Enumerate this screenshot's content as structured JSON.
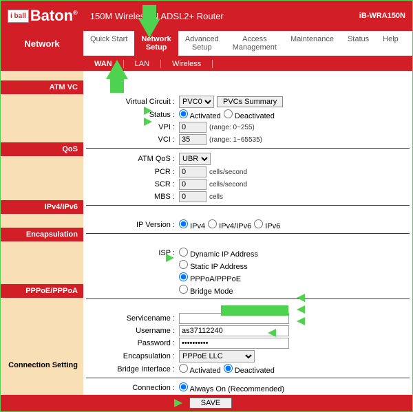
{
  "header": {
    "logo_small": "i ball",
    "logo_main": "Baton",
    "product": "150M Wireless-N ADSL2+ Router",
    "model": "iB-WRA150N"
  },
  "nav": {
    "network": "Network",
    "tabs": [
      "Quick Start",
      "Network Setup",
      "Advanced Setup",
      "Access Management",
      "Maintenance",
      "Status",
      "Help"
    ],
    "active_tab": 1,
    "subtabs": [
      "WAN",
      "LAN",
      "Wireless"
    ],
    "active_subtab": 0
  },
  "sections": {
    "atmvc": "ATM VC",
    "qos": "QoS",
    "ipv": "IPv4/IPv6",
    "encap": "Encapsulation",
    "pppoe": "PPPoE/PPPoA",
    "conn": "Connection Setting"
  },
  "fields": {
    "virtual_circuit_label": "Virtual Circuit :",
    "virtual_circuit_value": "PVC0",
    "pvcs_summary_btn": "PVCs Summary",
    "status_label": "Status :",
    "activated": "Activated",
    "deactivated": "Deactivated",
    "vpi_label": "VPI :",
    "vpi_value": "0",
    "vpi_hint": "(range: 0~255)",
    "vci_label": "VCI :",
    "vci_value": "35",
    "vci_hint": "(range: 1~65535)",
    "atmqos_label": "ATM QoS :",
    "atmqos_value": "UBR",
    "pcr_label": "PCR :",
    "pcr_value": "0",
    "scr_label": "SCR :",
    "scr_value": "0",
    "mbs_label": "MBS :",
    "mbs_value": "0",
    "cells_sec": "cells/second",
    "cells": "cells",
    "ipver_label": "IP Version :",
    "ipv4": "IPv4",
    "ipv4v6": "IPv4/IPv6",
    "ipv6": "IPv6",
    "isp_label": "ISP :",
    "dyn": "Dynamic IP Address",
    "stat": "Static IP Address",
    "pppoa": "PPPoA/PPPoE",
    "bridge": "Bridge Mode",
    "svc_label": "Servicename :",
    "svc_value": "",
    "user_label": "Username :",
    "user_value": "as37112240",
    "pass_label": "Password :",
    "pass_value": "••••••••••",
    "encap2_label": "Encapsulation :",
    "encap2_value": "PPPoE LLC",
    "brif_label": "Bridge Interface :",
    "conn_label": "Connection :",
    "always_on": "Always On (Recommended)",
    "save": "SAVE"
  }
}
